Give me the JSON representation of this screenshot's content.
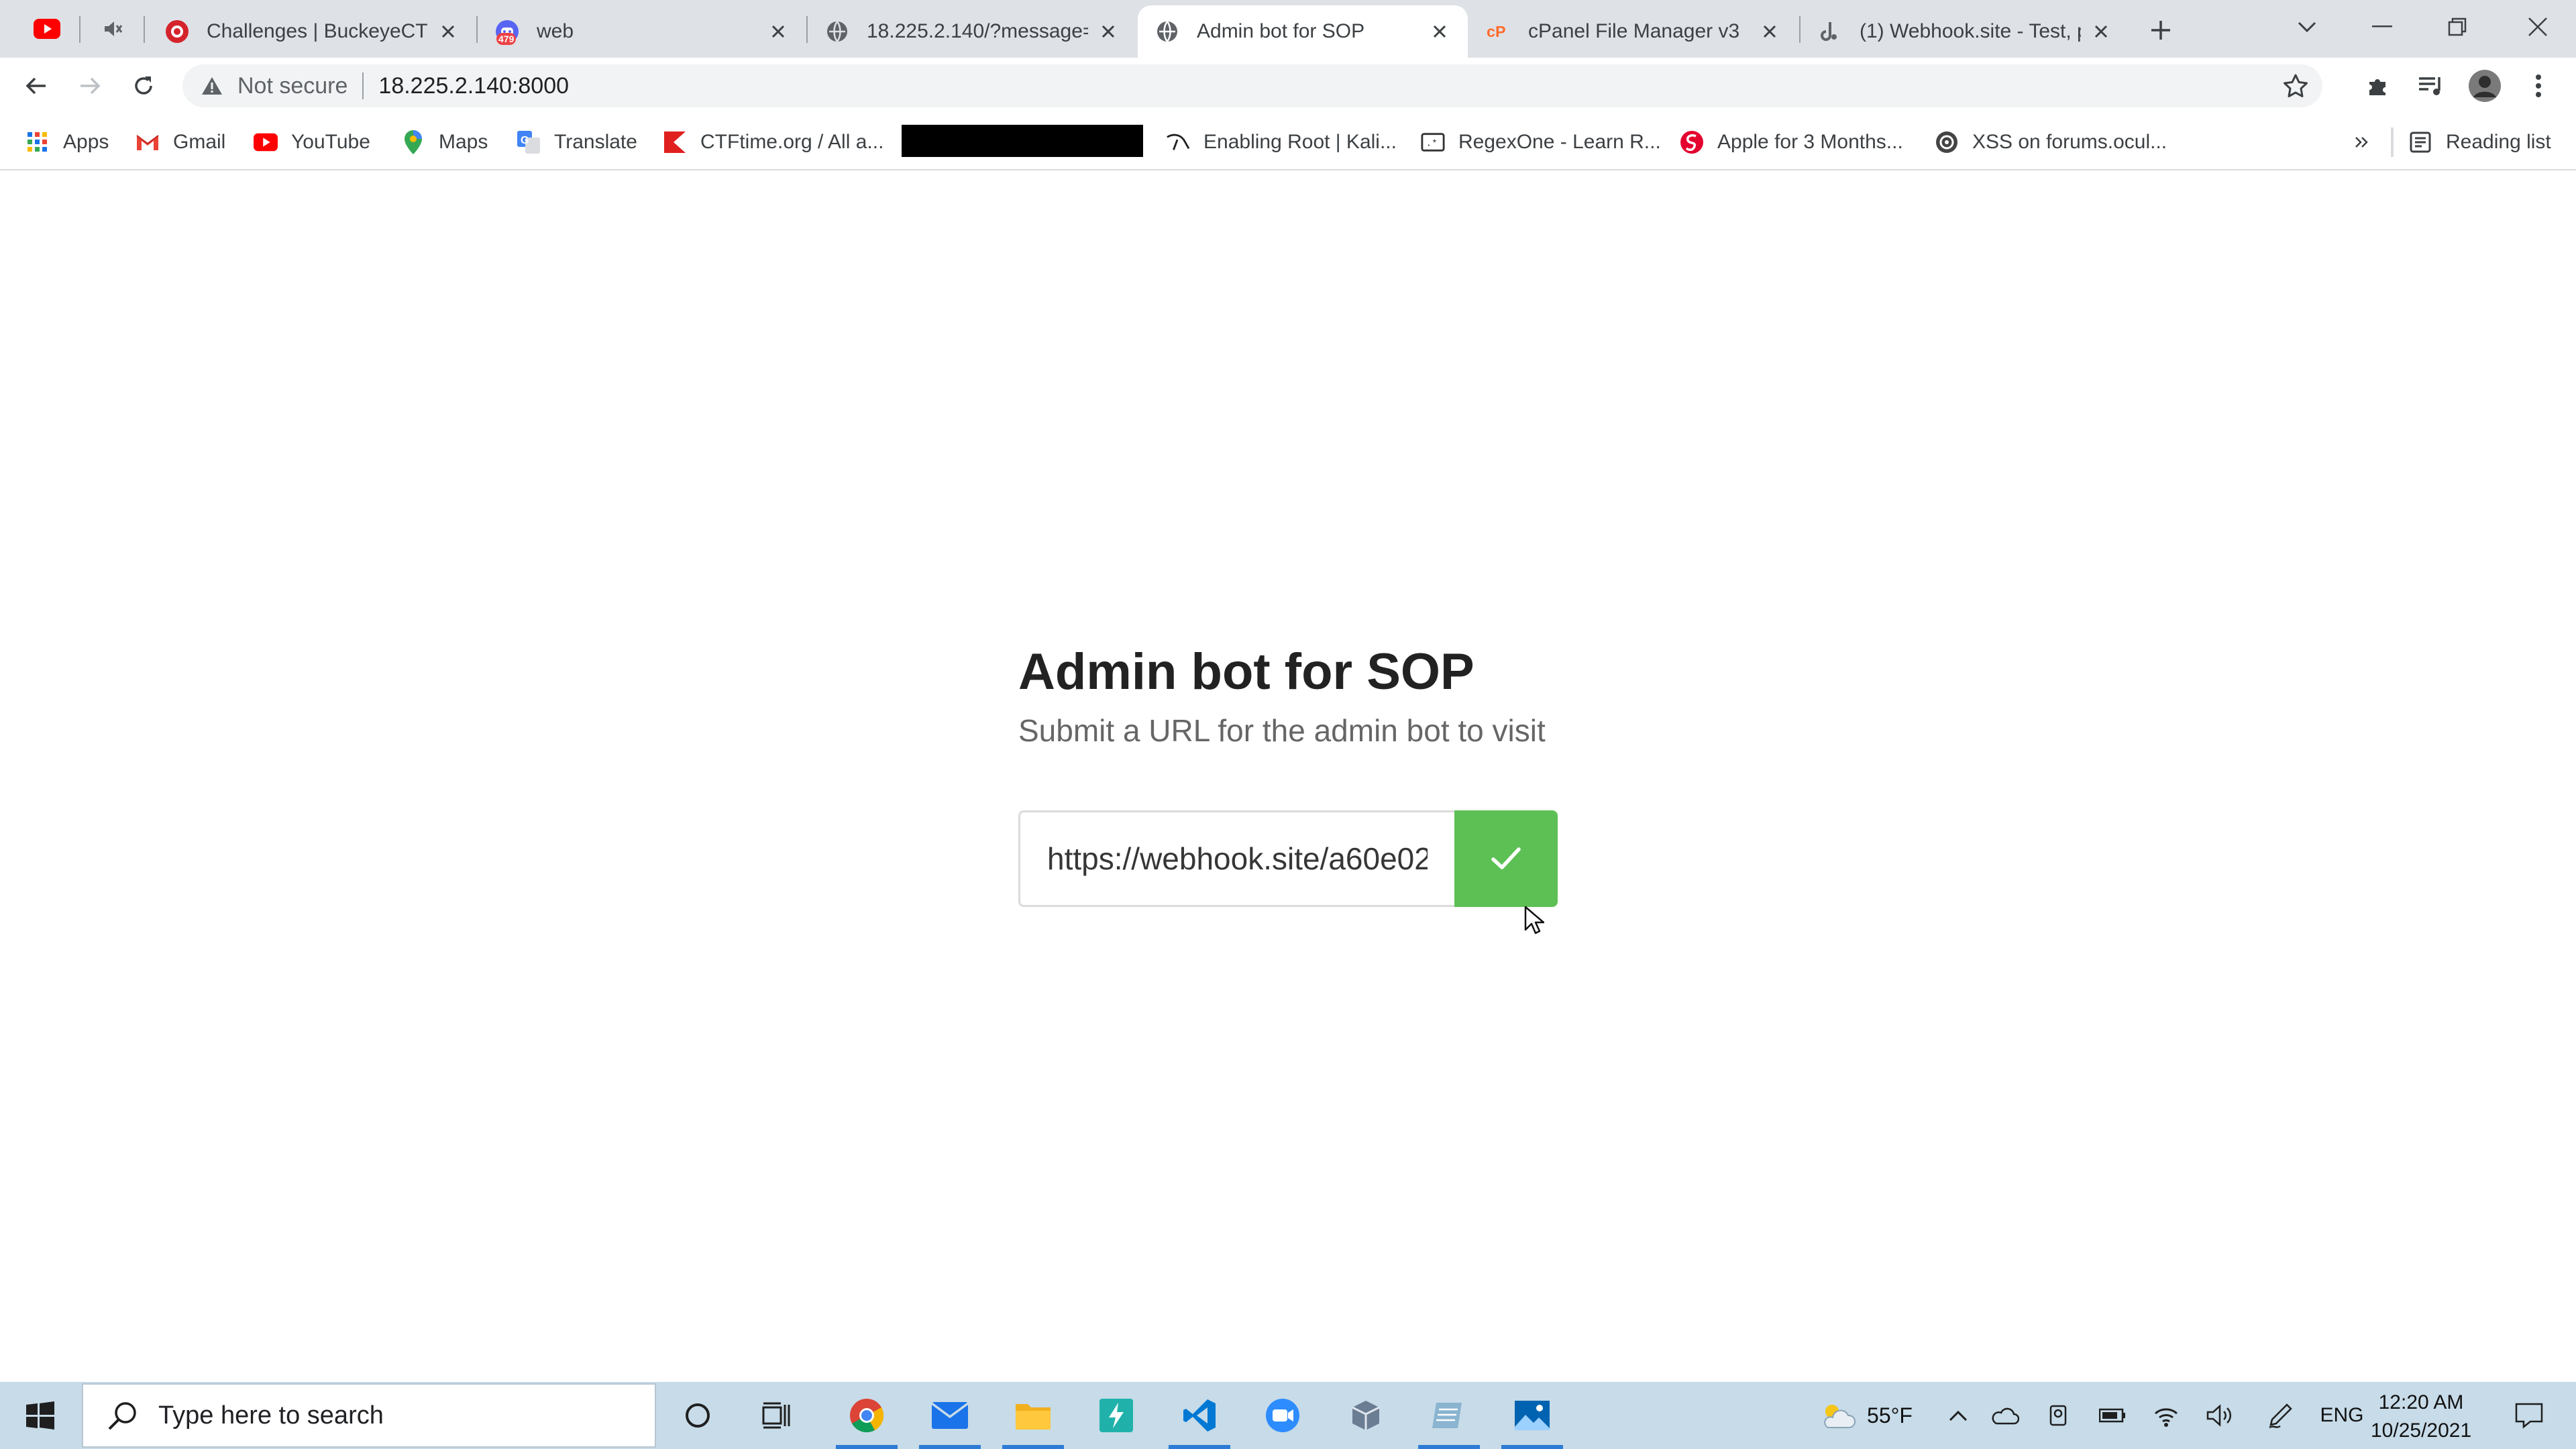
{
  "browser": {
    "tabs": [
      {
        "title": "Challenges | BuckeyeCTF",
        "favicon": "buckeye-icon",
        "active": false
      },
      {
        "title": "web",
        "favicon": "discord-icon",
        "badge": "479",
        "active": false
      },
      {
        "title": "18.225.2.140/?message=f",
        "favicon": "globe-icon",
        "active": false
      },
      {
        "title": "Admin bot for SOP",
        "favicon": "globe-icon",
        "active": true
      },
      {
        "title": "cPanel File Manager v3",
        "favicon": "cpanel-icon",
        "active": false
      },
      {
        "title": "(1) Webhook.site - Test, p",
        "favicon": "webhook-icon",
        "active": false
      }
    ],
    "address_bar": {
      "security_label": "Not secure",
      "url": "18.225.2.140:8000"
    },
    "bookmarks": [
      {
        "label": "Apps",
        "icon": "apps-grid-icon"
      },
      {
        "label": "Gmail",
        "icon": "gmail-icon"
      },
      {
        "label": "YouTube",
        "icon": "youtube-icon"
      },
      {
        "label": "Maps",
        "icon": "maps-pin-icon"
      },
      {
        "label": "Translate",
        "icon": "translate-icon"
      },
      {
        "label": "CTFtime.org / All a...",
        "icon": "ctftime-icon"
      },
      {
        "label": "Enabling Root | Kali...",
        "icon": "kali-icon"
      },
      {
        "label": "RegexOne - Learn R...",
        "icon": "regexone-icon"
      },
      {
        "label": "Apple for 3 Months...",
        "icon": "apple-deal-icon"
      },
      {
        "label": "XSS on forums.ocul...",
        "icon": "circle-logo-icon"
      }
    ],
    "reading_list_label": "Reading list"
  },
  "page": {
    "heading": "Admin bot for SOP",
    "subheading": "Submit a URL for the admin bot to visit",
    "url_input_value": "https://webhook.site/a60e02",
    "submit_icon": "checkmark-icon",
    "accent_color": "#5cc054"
  },
  "taskbar": {
    "search_placeholder": "Type here to search",
    "weather": "55°F",
    "language": "ENG",
    "time": "12:20 AM",
    "date": "10/25/2021"
  }
}
